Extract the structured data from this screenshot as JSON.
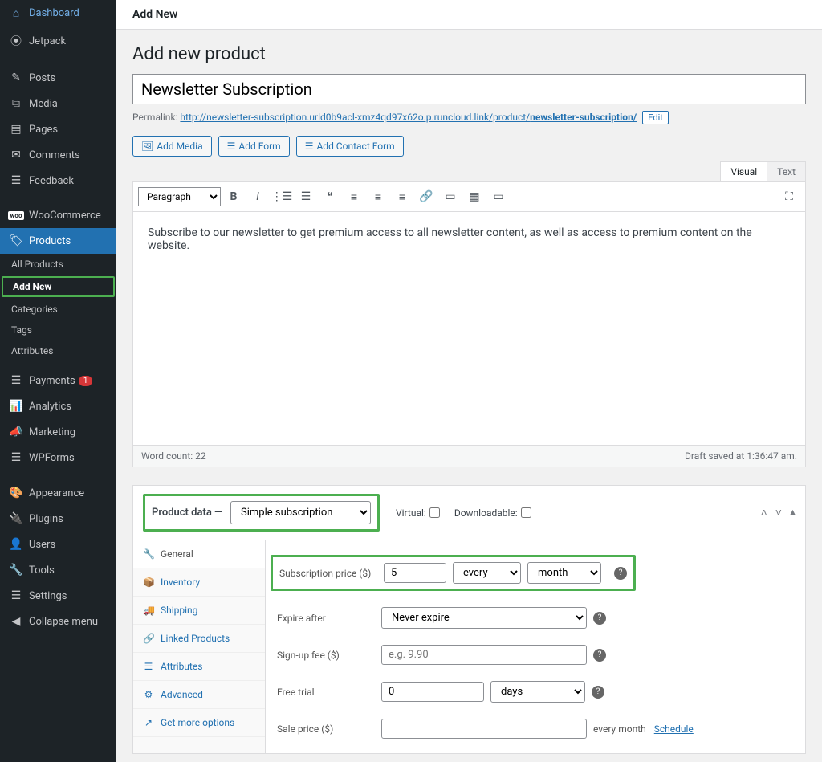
{
  "topbar": {
    "title": "Add New"
  },
  "sidebar": {
    "items": [
      {
        "icon": "⌂",
        "label": "Dashboard"
      },
      {
        "icon": "⦿",
        "label": "Jetpack"
      },
      {
        "icon": "✎",
        "label": "Posts"
      },
      {
        "icon": "⧉",
        "label": "Media"
      },
      {
        "icon": "▤",
        "label": "Pages"
      },
      {
        "icon": "✉",
        "label": "Comments"
      },
      {
        "icon": "☰",
        "label": "Feedback"
      },
      {
        "icon": "W",
        "label": "WooCommerce"
      },
      {
        "icon": "🏷",
        "label": "Products",
        "active": true
      },
      {
        "icon": "☰",
        "label": "Payments",
        "badge": "1"
      },
      {
        "icon": "📊",
        "label": "Analytics"
      },
      {
        "icon": "📣",
        "label": "Marketing"
      },
      {
        "icon": "☰",
        "label": "WPForms"
      },
      {
        "icon": "🎨",
        "label": "Appearance"
      },
      {
        "icon": "🔌",
        "label": "Plugins"
      },
      {
        "icon": "👤",
        "label": "Users"
      },
      {
        "icon": "🔧",
        "label": "Tools"
      },
      {
        "icon": "☰",
        "label": "Settings"
      },
      {
        "icon": "◀",
        "label": "Collapse menu"
      }
    ],
    "subitems": [
      {
        "label": "All Products"
      },
      {
        "label": "Add New",
        "current": true
      },
      {
        "label": "Categories"
      },
      {
        "label": "Tags"
      },
      {
        "label": "Attributes"
      }
    ]
  },
  "page": {
    "heading": "Add new product",
    "title_value": "Newsletter Subscription",
    "permalink_label": "Permalink:",
    "permalink_base": "http://newsletter-subscription.urld0b9acl-xmz4qd97x62o.p.runcloud.link/product/",
    "permalink_slug": "newsletter-subscription/",
    "edit_label": "Edit"
  },
  "media_buttons": {
    "add_media": "Add Media",
    "add_form": "Add Form",
    "add_contact": "Add Contact Form"
  },
  "editor": {
    "tabs": {
      "visual": "Visual",
      "text": "Text"
    },
    "format_select": "Paragraph",
    "body": "Subscribe to our newsletter to get premium access to all newsletter content, as well as access to premium content on the website.",
    "word_count_label": "Word count: 22",
    "draft_saved": "Draft saved at 1:36:47 am."
  },
  "product_data": {
    "label": "Product data —",
    "type_select": "Simple subscription",
    "virtual_label": "Virtual:",
    "downloadable_label": "Downloadable:",
    "tabs": [
      {
        "icon": "🔧",
        "label": "General",
        "active": true
      },
      {
        "icon": "📦",
        "label": "Inventory"
      },
      {
        "icon": "🚚",
        "label": "Shipping"
      },
      {
        "icon": "🔗",
        "label": "Linked Products"
      },
      {
        "icon": "☰",
        "label": "Attributes"
      },
      {
        "icon": "⚙",
        "label": "Advanced"
      },
      {
        "icon": "↗",
        "label": "Get more options"
      }
    ],
    "fields": {
      "sub_price_label": "Subscription price ($)",
      "sub_price_value": "5",
      "sub_interval": "every",
      "sub_period": "month",
      "expire_label": "Expire after",
      "expire_value": "Never expire",
      "signup_label": "Sign-up fee ($)",
      "signup_placeholder": "e.g. 9.90",
      "trial_label": "Free trial",
      "trial_value": "0",
      "trial_unit": "days",
      "sale_label": "Sale price ($)",
      "sale_suffix": "every month",
      "schedule": "Schedule"
    }
  }
}
